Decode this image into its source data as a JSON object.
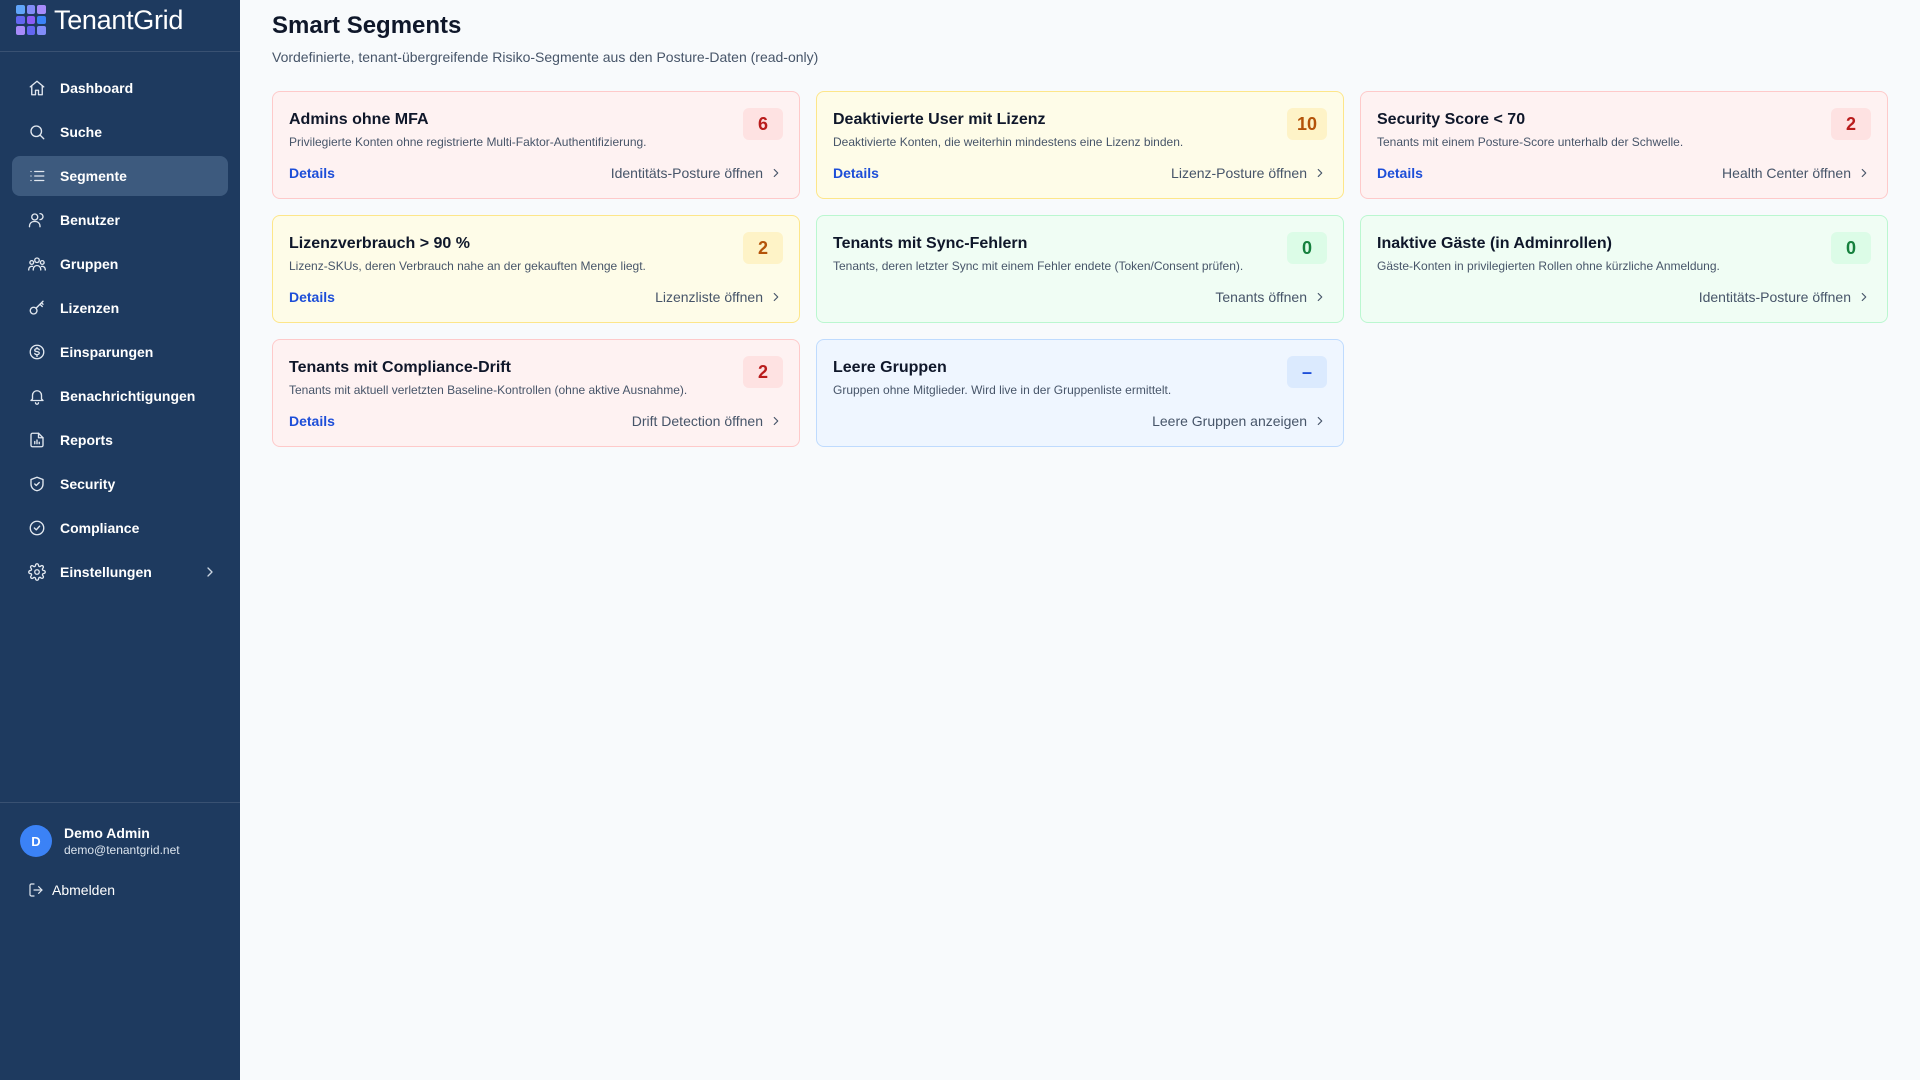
{
  "app": {
    "name": "TenantGrid",
    "logo_colors": [
      "#60a5fa",
      "#818cf8",
      "#a78bfa",
      "#6366f1",
      "#8b5cf6",
      "#3b82f6",
      "#a78bfa",
      "#6366f1",
      "#818cf8"
    ]
  },
  "sidebar": {
    "items": [
      {
        "label": "Dashboard",
        "icon": "home-icon",
        "active": false
      },
      {
        "label": "Suche",
        "icon": "search-icon",
        "active": false
      },
      {
        "label": "Segmente",
        "icon": "list-icon",
        "active": true
      },
      {
        "label": "Benutzer",
        "icon": "user-icon",
        "active": false
      },
      {
        "label": "Gruppen",
        "icon": "users-icon",
        "active": false
      },
      {
        "label": "Lizenzen",
        "icon": "key-icon",
        "active": false
      },
      {
        "label": "Einsparungen",
        "icon": "dollar-circle-icon",
        "active": false
      },
      {
        "label": "Benachrichtigungen",
        "icon": "bell-icon",
        "active": false
      },
      {
        "label": "Reports",
        "icon": "file-chart-icon",
        "active": false
      },
      {
        "label": "Security",
        "icon": "shield-icon",
        "active": false
      },
      {
        "label": "Compliance",
        "icon": "check-circle-icon",
        "active": false
      },
      {
        "label": "Einstellungen",
        "icon": "gear-icon",
        "active": false,
        "expandable": true
      }
    ],
    "user": {
      "initial": "D",
      "name": "Demo Admin",
      "email": "demo@tenantgrid.net"
    },
    "logout_label": "Abmelden"
  },
  "page": {
    "title": "Smart Segments",
    "subtitle": "Vordefinierte, tenant-übergreifende Risiko-Segmente aus den Posture-Daten (read-only)"
  },
  "segments": [
    {
      "title": "Admins ohne MFA",
      "description": "Privilegierte Konten ohne registrierte Multi-Faktor-Authentifizierung.",
      "count": "6",
      "tone": "red",
      "details": "Details",
      "link": "Identitäts-Posture öffnen"
    },
    {
      "title": "Deaktivierte User mit Lizenz",
      "description": "Deaktivierte Konten, die weiterhin mindestens eine Lizenz binden.",
      "count": "10",
      "tone": "yellow",
      "details": "Details",
      "link": "Lizenz-Posture öffnen"
    },
    {
      "title": "Security Score < 70",
      "description": "Tenants mit einem Posture-Score unterhalb der Schwelle.",
      "count": "2",
      "tone": "red",
      "details": "Details",
      "link": "Health Center öffnen"
    },
    {
      "title": "Lizenzverbrauch > 90 %",
      "description": "Lizenz-SKUs, deren Verbrauch nahe an der gekauften Menge liegt.",
      "count": "2",
      "tone": "yellow",
      "details": "Details",
      "link": "Lizenzliste öffnen"
    },
    {
      "title": "Tenants mit Sync-Fehlern",
      "description": "Tenants, deren letzter Sync mit einem Fehler endete (Token/Consent prüfen).",
      "count": "0",
      "tone": "green",
      "details": "",
      "link": "Tenants öffnen"
    },
    {
      "title": "Inaktive Gäste (in Adminrollen)",
      "description": "Gäste-Konten in privilegierten Rollen ohne kürzliche Anmeldung.",
      "count": "0",
      "tone": "green",
      "details": "",
      "link": "Identitäts-Posture öffnen"
    },
    {
      "title": "Tenants mit Compliance-Drift",
      "description": "Tenants mit aktuell verletzten Baseline-Kontrollen (ohne aktive Ausnahme).",
      "count": "2",
      "tone": "red",
      "details": "Details",
      "link": "Drift Detection öffnen"
    },
    {
      "title": "Leere Gruppen",
      "description": "Gruppen ohne Mitglieder. Wird live in der Gruppenliste ermittelt.",
      "count": "–",
      "tone": "blue",
      "details": "",
      "link": "Leere Gruppen anzeigen"
    }
  ]
}
